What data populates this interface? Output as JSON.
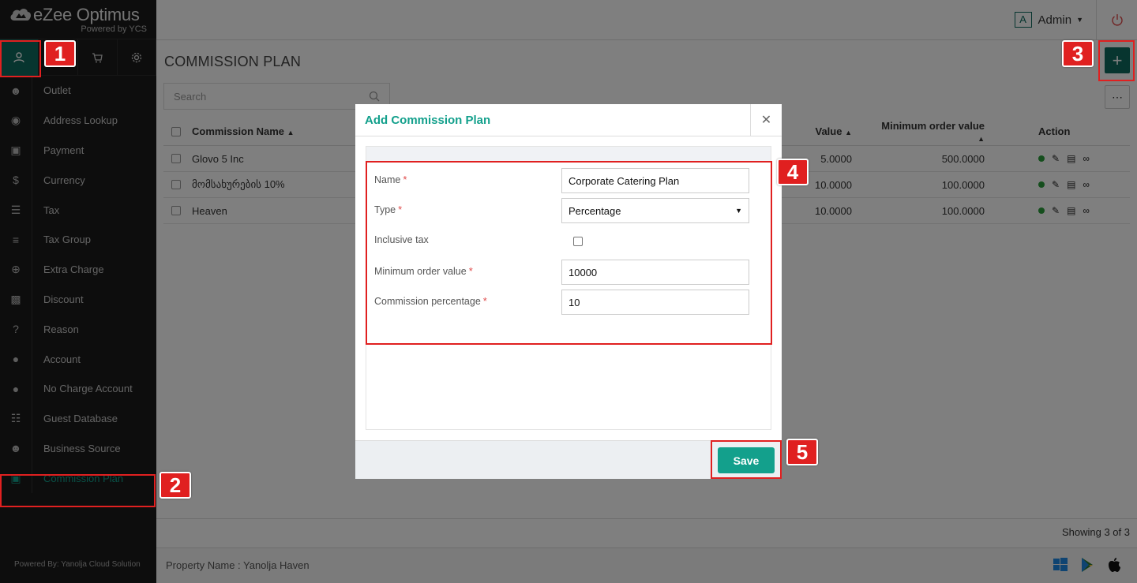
{
  "brand": {
    "name": "eZee Optimus",
    "sub": "Powered by YCS"
  },
  "header": {
    "admin_initial": "A",
    "admin_name": "Admin"
  },
  "sidebar": {
    "items": [
      {
        "label": "Outlet",
        "icon": "user-icon"
      },
      {
        "label": "Address Lookup",
        "icon": "map-pin-icon"
      },
      {
        "label": "Payment",
        "icon": "credit-card-icon"
      },
      {
        "label": "Currency",
        "icon": "dollar-icon"
      },
      {
        "label": "Tax",
        "icon": "menu-lines-icon"
      },
      {
        "label": "Tax Group",
        "icon": "list-icon"
      },
      {
        "label": "Extra Charge",
        "icon": "plus-circle-icon"
      },
      {
        "label": "Discount",
        "icon": "gift-icon"
      },
      {
        "label": "Reason",
        "icon": "question-icon"
      },
      {
        "label": "Account",
        "icon": "user-solid-icon"
      },
      {
        "label": "No Charge Account",
        "icon": "user-solid-icon"
      },
      {
        "label": "Guest Database",
        "icon": "database-icon"
      },
      {
        "label": "Business Source",
        "icon": "users-icon"
      },
      {
        "label": "Commission Plan",
        "icon": "money-icon"
      }
    ],
    "footer": "Powered By: Yanolja Cloud Solution"
  },
  "main": {
    "title": "COMMISSION PLAN",
    "search_placeholder": "Search",
    "columns": {
      "name": "Commission Name",
      "value": "Value",
      "min": "Minimum order value",
      "action": "Action"
    },
    "rows": [
      {
        "name": "Glovo 5 Inc",
        "value": "5.0000",
        "min": "500.0000"
      },
      {
        "name": "მომსახურების 10%",
        "value": "10.0000",
        "min": "100.0000"
      },
      {
        "name": "Heaven",
        "value": "10.0000",
        "min": "100.0000"
      }
    ],
    "showing": "Showing 3 of 3"
  },
  "footer": {
    "property": "Property Name : Yanolja Haven"
  },
  "modal": {
    "title": "Add Commission Plan",
    "fields": {
      "name_label": "Name",
      "name_value": "Corporate Catering Plan",
      "type_label": "Type",
      "type_value": "Percentage",
      "inclusive_label": "Inclusive tax",
      "min_label": "Minimum order value",
      "min_value": "10000",
      "pct_label": "Commission percentage",
      "pct_value": "10"
    },
    "save_label": "Save"
  },
  "annotations": [
    "1",
    "2",
    "3",
    "4",
    "5"
  ],
  "colors": {
    "accent": "#13a08c",
    "dark_accent": "#0e6b5f",
    "highlight": "#e02020"
  }
}
